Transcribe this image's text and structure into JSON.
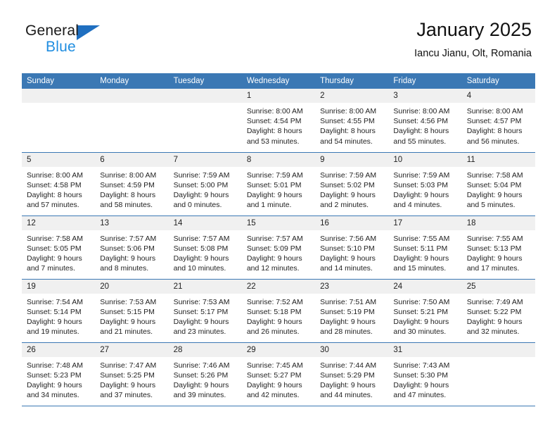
{
  "brand": {
    "line1": "General",
    "line2": "Blue",
    "triangle_color": "#1f6fc0",
    "blue_text_color": "#1f8de0"
  },
  "header": {
    "title": "January 2025",
    "location": "Iancu Jianu, Olt, Romania",
    "accent_color": "#3b78b4",
    "daynum_band_color": "#f0f0f0"
  },
  "weekday_headers": [
    "Sunday",
    "Monday",
    "Tuesday",
    "Wednesday",
    "Thursday",
    "Friday",
    "Saturday"
  ],
  "weeks": [
    [
      {
        "day": "",
        "sunrise": "",
        "sunset": "",
        "daylight1": "",
        "daylight2": "",
        "blank": true
      },
      {
        "day": "",
        "sunrise": "",
        "sunset": "",
        "daylight1": "",
        "daylight2": "",
        "blank": true
      },
      {
        "day": "",
        "sunrise": "",
        "sunset": "",
        "daylight1": "",
        "daylight2": "",
        "blank": true
      },
      {
        "day": "1",
        "sunrise": "Sunrise: 8:00 AM",
        "sunset": "Sunset: 4:54 PM",
        "daylight1": "Daylight: 8 hours",
        "daylight2": "and 53 minutes."
      },
      {
        "day": "2",
        "sunrise": "Sunrise: 8:00 AM",
        "sunset": "Sunset: 4:55 PM",
        "daylight1": "Daylight: 8 hours",
        "daylight2": "and 54 minutes."
      },
      {
        "day": "3",
        "sunrise": "Sunrise: 8:00 AM",
        "sunset": "Sunset: 4:56 PM",
        "daylight1": "Daylight: 8 hours",
        "daylight2": "and 55 minutes."
      },
      {
        "day": "4",
        "sunrise": "Sunrise: 8:00 AM",
        "sunset": "Sunset: 4:57 PM",
        "daylight1": "Daylight: 8 hours",
        "daylight2": "and 56 minutes."
      }
    ],
    [
      {
        "day": "5",
        "sunrise": "Sunrise: 8:00 AM",
        "sunset": "Sunset: 4:58 PM",
        "daylight1": "Daylight: 8 hours",
        "daylight2": "and 57 minutes."
      },
      {
        "day": "6",
        "sunrise": "Sunrise: 8:00 AM",
        "sunset": "Sunset: 4:59 PM",
        "daylight1": "Daylight: 8 hours",
        "daylight2": "and 58 minutes."
      },
      {
        "day": "7",
        "sunrise": "Sunrise: 7:59 AM",
        "sunset": "Sunset: 5:00 PM",
        "daylight1": "Daylight: 9 hours",
        "daylight2": "and 0 minutes."
      },
      {
        "day": "8",
        "sunrise": "Sunrise: 7:59 AM",
        "sunset": "Sunset: 5:01 PM",
        "daylight1": "Daylight: 9 hours",
        "daylight2": "and 1 minute."
      },
      {
        "day": "9",
        "sunrise": "Sunrise: 7:59 AM",
        "sunset": "Sunset: 5:02 PM",
        "daylight1": "Daylight: 9 hours",
        "daylight2": "and 2 minutes."
      },
      {
        "day": "10",
        "sunrise": "Sunrise: 7:59 AM",
        "sunset": "Sunset: 5:03 PM",
        "daylight1": "Daylight: 9 hours",
        "daylight2": "and 4 minutes."
      },
      {
        "day": "11",
        "sunrise": "Sunrise: 7:58 AM",
        "sunset": "Sunset: 5:04 PM",
        "daylight1": "Daylight: 9 hours",
        "daylight2": "and 5 minutes."
      }
    ],
    [
      {
        "day": "12",
        "sunrise": "Sunrise: 7:58 AM",
        "sunset": "Sunset: 5:05 PM",
        "daylight1": "Daylight: 9 hours",
        "daylight2": "and 7 minutes."
      },
      {
        "day": "13",
        "sunrise": "Sunrise: 7:57 AM",
        "sunset": "Sunset: 5:06 PM",
        "daylight1": "Daylight: 9 hours",
        "daylight2": "and 8 minutes."
      },
      {
        "day": "14",
        "sunrise": "Sunrise: 7:57 AM",
        "sunset": "Sunset: 5:08 PM",
        "daylight1": "Daylight: 9 hours",
        "daylight2": "and 10 minutes."
      },
      {
        "day": "15",
        "sunrise": "Sunrise: 7:57 AM",
        "sunset": "Sunset: 5:09 PM",
        "daylight1": "Daylight: 9 hours",
        "daylight2": "and 12 minutes."
      },
      {
        "day": "16",
        "sunrise": "Sunrise: 7:56 AM",
        "sunset": "Sunset: 5:10 PM",
        "daylight1": "Daylight: 9 hours",
        "daylight2": "and 14 minutes."
      },
      {
        "day": "17",
        "sunrise": "Sunrise: 7:55 AM",
        "sunset": "Sunset: 5:11 PM",
        "daylight1": "Daylight: 9 hours",
        "daylight2": "and 15 minutes."
      },
      {
        "day": "18",
        "sunrise": "Sunrise: 7:55 AM",
        "sunset": "Sunset: 5:13 PM",
        "daylight1": "Daylight: 9 hours",
        "daylight2": "and 17 minutes."
      }
    ],
    [
      {
        "day": "19",
        "sunrise": "Sunrise: 7:54 AM",
        "sunset": "Sunset: 5:14 PM",
        "daylight1": "Daylight: 9 hours",
        "daylight2": "and 19 minutes."
      },
      {
        "day": "20",
        "sunrise": "Sunrise: 7:53 AM",
        "sunset": "Sunset: 5:15 PM",
        "daylight1": "Daylight: 9 hours",
        "daylight2": "and 21 minutes."
      },
      {
        "day": "21",
        "sunrise": "Sunrise: 7:53 AM",
        "sunset": "Sunset: 5:17 PM",
        "daylight1": "Daylight: 9 hours",
        "daylight2": "and 23 minutes."
      },
      {
        "day": "22",
        "sunrise": "Sunrise: 7:52 AM",
        "sunset": "Sunset: 5:18 PM",
        "daylight1": "Daylight: 9 hours",
        "daylight2": "and 26 minutes."
      },
      {
        "day": "23",
        "sunrise": "Sunrise: 7:51 AM",
        "sunset": "Sunset: 5:19 PM",
        "daylight1": "Daylight: 9 hours",
        "daylight2": "and 28 minutes."
      },
      {
        "day": "24",
        "sunrise": "Sunrise: 7:50 AM",
        "sunset": "Sunset: 5:21 PM",
        "daylight1": "Daylight: 9 hours",
        "daylight2": "and 30 minutes."
      },
      {
        "day": "25",
        "sunrise": "Sunrise: 7:49 AM",
        "sunset": "Sunset: 5:22 PM",
        "daylight1": "Daylight: 9 hours",
        "daylight2": "and 32 minutes."
      }
    ],
    [
      {
        "day": "26",
        "sunrise": "Sunrise: 7:48 AM",
        "sunset": "Sunset: 5:23 PM",
        "daylight1": "Daylight: 9 hours",
        "daylight2": "and 34 minutes."
      },
      {
        "day": "27",
        "sunrise": "Sunrise: 7:47 AM",
        "sunset": "Sunset: 5:25 PM",
        "daylight1": "Daylight: 9 hours",
        "daylight2": "and 37 minutes."
      },
      {
        "day": "28",
        "sunrise": "Sunrise: 7:46 AM",
        "sunset": "Sunset: 5:26 PM",
        "daylight1": "Daylight: 9 hours",
        "daylight2": "and 39 minutes."
      },
      {
        "day": "29",
        "sunrise": "Sunrise: 7:45 AM",
        "sunset": "Sunset: 5:27 PM",
        "daylight1": "Daylight: 9 hours",
        "daylight2": "and 42 minutes."
      },
      {
        "day": "30",
        "sunrise": "Sunrise: 7:44 AM",
        "sunset": "Sunset: 5:29 PM",
        "daylight1": "Daylight: 9 hours",
        "daylight2": "and 44 minutes."
      },
      {
        "day": "31",
        "sunrise": "Sunrise: 7:43 AM",
        "sunset": "Sunset: 5:30 PM",
        "daylight1": "Daylight: 9 hours",
        "daylight2": "and 47 minutes."
      },
      {
        "day": "",
        "sunrise": "",
        "sunset": "",
        "daylight1": "",
        "daylight2": "",
        "blank": true
      }
    ]
  ]
}
